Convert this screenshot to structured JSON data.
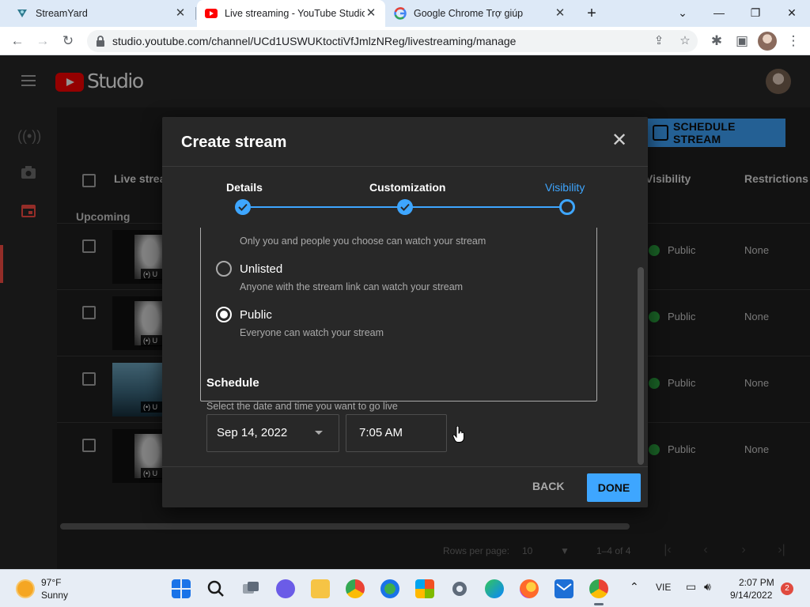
{
  "browser": {
    "tabs": [
      {
        "title": "StreamYard",
        "icon": "streamyard-icon"
      },
      {
        "title": "Live streaming - YouTube Studio",
        "icon": "youtube-icon"
      },
      {
        "title": "Google Chrome Trợ giúp",
        "icon": "google-icon"
      }
    ],
    "url": "studio.youtube.com/channel/UCd1USWUKtoctiVfJmlzNReg/livestreaming/manage"
  },
  "studio": {
    "logo_text": "Studio",
    "schedule_button": "SCHEDULE STREAM",
    "columns": {
      "live_stream": "Live strea",
      "visibility": "Visibility",
      "restrictions": "Restrictions"
    },
    "section": "Upcoming",
    "rows": [
      {
        "visibility": "Public",
        "restrictions": "None",
        "badge": "U"
      },
      {
        "visibility": "Public",
        "restrictions": "None",
        "badge": "U"
      },
      {
        "visibility": "Public",
        "restrictions": "None",
        "badge": "U"
      },
      {
        "visibility": "Public",
        "restrictions": "None",
        "badge": "U"
      }
    ],
    "pagination": {
      "rows_per_page_label": "Rows per page:",
      "rows_per_page": "10",
      "range": "1–4 of 4"
    }
  },
  "dialog": {
    "title": "Create stream",
    "steps": [
      "Details",
      "Customization",
      "Visibility"
    ],
    "options": {
      "private_desc": "Only you and people you choose can watch your stream",
      "unlisted_label": "Unlisted",
      "unlisted_desc": "Anyone with the stream link can watch your stream",
      "public_label": "Public",
      "public_desc": "Everyone can watch your stream",
      "selected": "Public"
    },
    "schedule": {
      "title": "Schedule",
      "desc": "Select the date and time you want to go live",
      "date": "Sep 14, 2022",
      "time": "7:05 AM"
    },
    "back_label": "BACK",
    "done_label": "DONE"
  },
  "taskbar": {
    "temp": "97°F",
    "condition": "Sunny",
    "language": "VIE",
    "time": "2:07 PM",
    "date": "9/14/2022",
    "notifications": "2"
  },
  "colors": {
    "accent": "#3ea6ff",
    "youtube_red": "#ff0000",
    "public_green": "#2ba640"
  }
}
